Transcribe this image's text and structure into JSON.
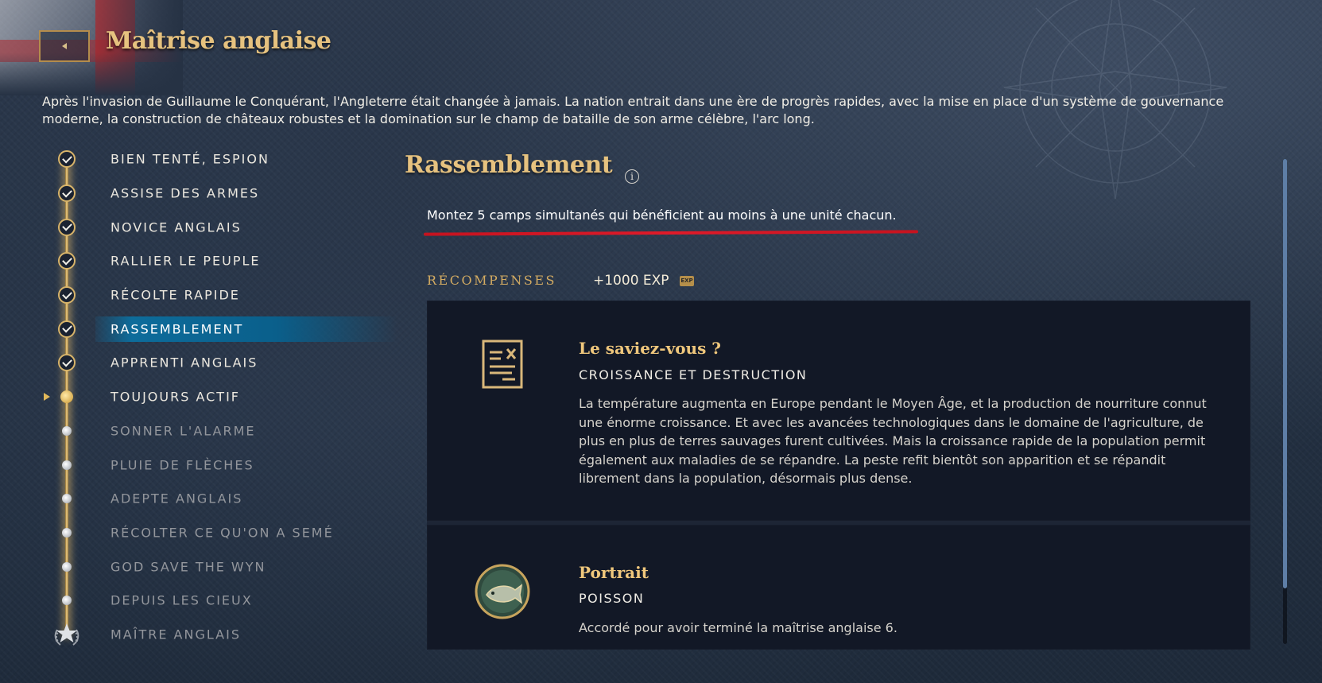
{
  "header": {
    "title": "Maîtrise anglaise",
    "intro": "Après l'invasion de Guillaume le Conquérant, l'Angleterre était changée à jamais. La nation entrait dans une ère de progrès rapides, avec la mise en place d'un système de gouvernance moderne, la construction de châteaux robustes et la domination sur le champ de bataille de son arme célèbre, l'arc long."
  },
  "milestones": [
    {
      "label": "BIEN TENTÉ, ESPION",
      "state": "completed"
    },
    {
      "label": "ASSISE DES ARMES",
      "state": "completed"
    },
    {
      "label": "NOVICE ANGLAIS",
      "state": "completed"
    },
    {
      "label": "RALLIER LE PEUPLE",
      "state": "completed"
    },
    {
      "label": "RÉCOLTE RAPIDE",
      "state": "completed"
    },
    {
      "label": "RASSEMBLEMENT",
      "state": "completed",
      "selected": true
    },
    {
      "label": "APPRENTI ANGLAIS",
      "state": "completed"
    },
    {
      "label": "TOUJOURS ACTIF",
      "state": "current"
    },
    {
      "label": "SONNER L'ALARME",
      "state": "locked"
    },
    {
      "label": "PLUIE DE FLÈCHES",
      "state": "locked"
    },
    {
      "label": "ADEPTE ANGLAIS",
      "state": "locked"
    },
    {
      "label": "RÉCOLTER CE QU'ON A SEMÉ",
      "state": "locked"
    },
    {
      "label": "GOD SAVE THE WYN",
      "state": "locked"
    },
    {
      "label": "DEPUIS LES CIEUX",
      "state": "locked"
    },
    {
      "label": "MAÎTRE ANGLAIS",
      "state": "final"
    }
  ],
  "detail": {
    "title": "Rassemblement",
    "info_icon": "i",
    "objective": "Montez 5 camps simultanés qui bénéficient au moins à une unité chacun.",
    "rewards_label": "RÉCOMPENSES",
    "exp": "+1000 EXP",
    "exp_badge": "EXP",
    "rewards": [
      {
        "icon": "document-icon",
        "heading": "Le saviez-vous ?",
        "subheading": "CROISSANCE ET DESTRUCTION",
        "text": "La température augmenta en Europe pendant le Moyen Âge, et la production de nourriture connut une énorme croissance. Et avec les avancées technologiques dans le domaine de l'agriculture, de plus en plus de terres sauvages furent cultivées. Mais la croissance rapide de la population permit également aux maladies de se répandre. La peste refit bientôt son apparition et se répandit librement dans la population, désormais plus dense."
      },
      {
        "icon": "fish-portrait-icon",
        "heading": "Portrait",
        "subheading": "POISSON",
        "text": "Accordé pour avoir terminé la maîtrise anglaise 6."
      }
    ]
  },
  "colors": {
    "gold": "#e6c27f",
    "selected": "#0d6c9b",
    "underline": "#e01a29",
    "card_bg": "#121826"
  }
}
